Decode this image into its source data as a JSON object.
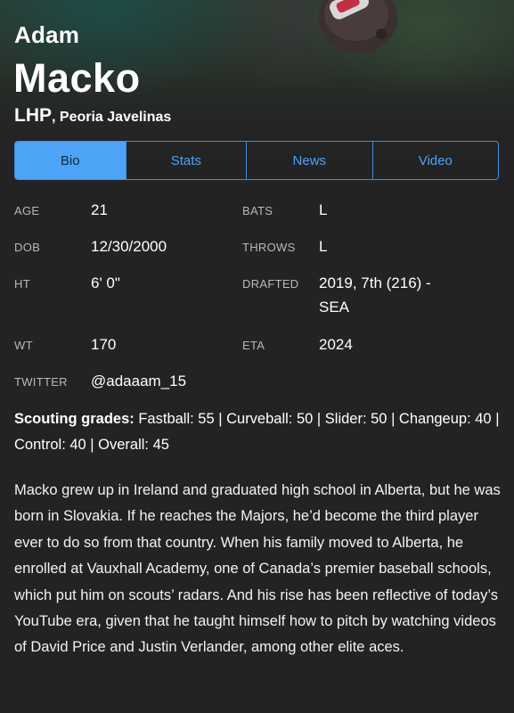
{
  "player": {
    "first_name": "Adam",
    "last_name": "Macko",
    "position": "LHP",
    "separator": ",",
    "team": "Peoria Javelinas"
  },
  "tabs": [
    {
      "label": "Bio",
      "active": true
    },
    {
      "label": "Stats",
      "active": false
    },
    {
      "label": "News",
      "active": false
    },
    {
      "label": "Video",
      "active": false
    }
  ],
  "info": {
    "age_label": "AGE",
    "age": "21",
    "bats_label": "BATS",
    "bats": "L",
    "dob_label": "DOB",
    "dob": "12/30/2000",
    "throws_label": "THROWS",
    "throws": "L",
    "ht_label": "HT",
    "ht": "6' 0\"",
    "drafted_label": "DRAFTED",
    "drafted_line1": "2019, 7th (216) -",
    "drafted_line2": "SEA",
    "wt_label": "WT",
    "wt": "170",
    "eta_label": "ETA",
    "eta": "2024",
    "twitter_label": "TWITTER",
    "twitter": "@adaaam_15"
  },
  "scouting": {
    "label": "Scouting grades:",
    "text": " Fastball: 55 | Curveball: 50 | Slider: 50 | Changeup: 40 | Control: 40 | Overall: 45"
  },
  "bio": "Macko grew up in Ireland and graduated high school in Alberta, but he was born in Slovakia. If he reaches the Majors, he’d become the third player ever to do so from that country. When his family moved to Alberta, he enrolled at Vauxhall Academy, one of Canada’s premier baseball schools, which put him on scouts’ radars. And his rise has been reflective of today’s YouTube era, given that he taught himself how to pitch by watching videos of David Price and Justin Verlander, among other elite aces.",
  "colors": {
    "background": "#232323",
    "accent": "#4da3f5",
    "label_gray": "#b8b8b8"
  }
}
